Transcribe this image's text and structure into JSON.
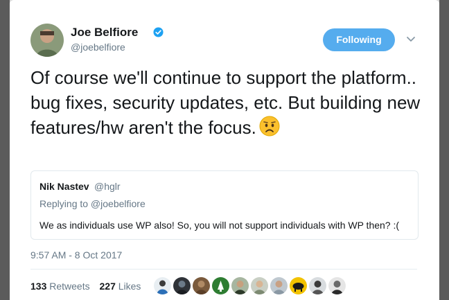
{
  "author": {
    "name": "Joe Belfiore",
    "handle": "@joebelfiore"
  },
  "follow_label": "Following",
  "tweet": {
    "text": "Of course we'll continue to support the platform.. bug fixes, security updates, etc. But building new features/hw aren't the focus."
  },
  "quote": {
    "name": "Nik Nastev",
    "handle": "@hglr",
    "replying_to": "Replying to @joebelfiore",
    "text": "We as individuals use WP also! So, you will not support individuals with WP then? :("
  },
  "timestamp": "9:57 AM - 8 Oct 2017",
  "stats": {
    "retweets_count": "133",
    "retweets_label": "Retweets",
    "likes_count": "227",
    "likes_label": "Likes"
  },
  "colors": {
    "accent": "#55acee",
    "text": "#14171a",
    "muted": "#657786",
    "border": "#e1e8ed"
  },
  "icons": [
    "verified-badge-icon",
    "chevron-down-icon",
    "worried-face-emoji-icon"
  ]
}
